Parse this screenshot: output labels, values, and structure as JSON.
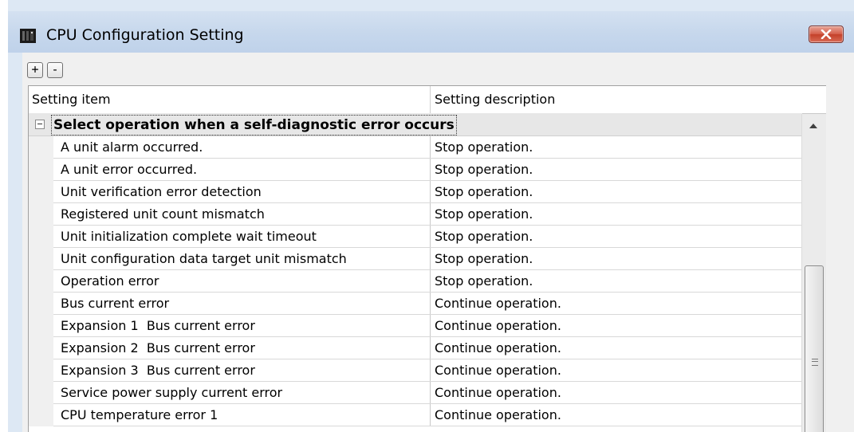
{
  "window": {
    "title": "CPU Configuration Setting",
    "close_label": "x"
  },
  "toolbar": {
    "expand_label": "+",
    "collapse_label": "-"
  },
  "grid": {
    "columns": [
      "Setting item",
      "Setting description"
    ],
    "group_title": "Select operation when a self-diagnostic error occurs",
    "rows": [
      {
        "item": "A unit alarm occurred.",
        "value": "Stop operation."
      },
      {
        "item": "A unit error occurred.",
        "value": "Stop operation."
      },
      {
        "item": "Unit verification error detection",
        "value": "Stop operation."
      },
      {
        "item": "Registered unit count mismatch",
        "value": "Stop operation."
      },
      {
        "item": "Unit initialization complete wait timeout",
        "value": "Stop operation."
      },
      {
        "item": "Unit configuration data target unit mismatch",
        "value": "Stop operation."
      },
      {
        "item": "Operation error",
        "value": "Stop operation."
      },
      {
        "item": "Bus current error",
        "value": "Continue operation."
      },
      {
        "item": "Expansion 1  Bus current error",
        "value": "Continue operation."
      },
      {
        "item": "Expansion 2  Bus current error",
        "value": "Continue operation."
      },
      {
        "item": "Expansion 3  Bus current error",
        "value": "Continue operation."
      },
      {
        "item": "Service power supply current error",
        "value": "Continue operation."
      },
      {
        "item": "CPU temperature error 1",
        "value": "Continue operation."
      }
    ]
  },
  "icons": {
    "app": "cpu-module-icon",
    "close": "close-icon",
    "collapse_group": "collapse-minus-icon",
    "scroll_up": "scroll-up-arrow-icon"
  },
  "colors": {
    "titlebar": "#c6d7ec",
    "close_button": "#c4412a"
  }
}
